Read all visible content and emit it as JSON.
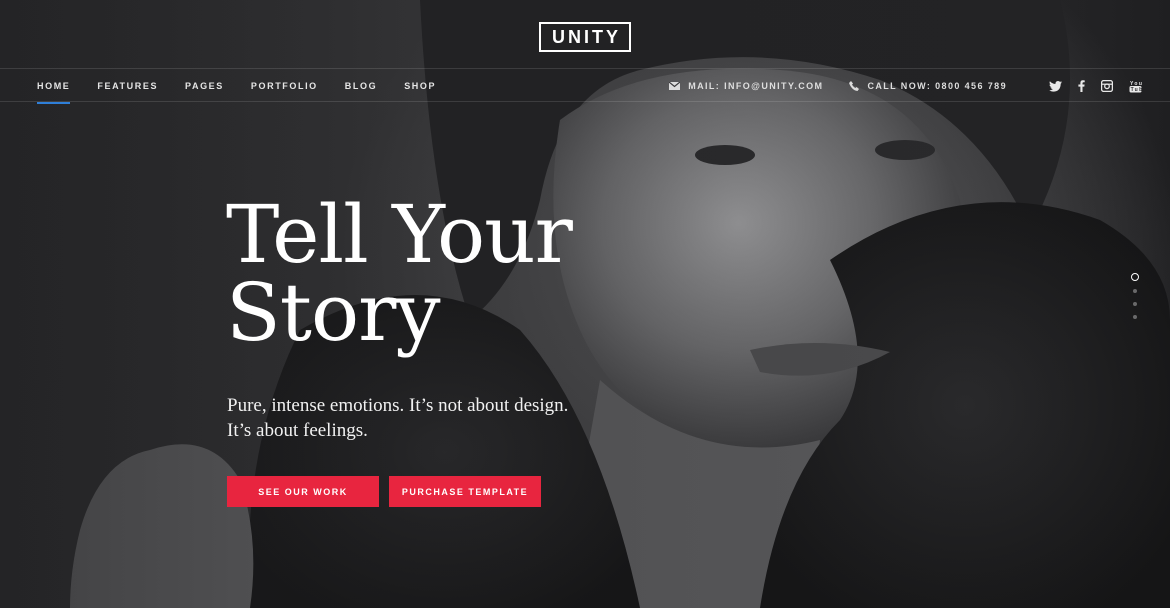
{
  "brand": {
    "logo_text": "UNITY"
  },
  "nav": {
    "items": [
      {
        "label": "HOME",
        "active": true
      },
      {
        "label": "FEATURES",
        "active": false
      },
      {
        "label": "PAGES",
        "active": false
      },
      {
        "label": "PORTFOLIO",
        "active": false
      },
      {
        "label": "BLOG",
        "active": false
      },
      {
        "label": "SHOP",
        "active": false
      }
    ],
    "active_color": "#2f7fd8"
  },
  "contact": {
    "mail": {
      "icon": "envelope-icon",
      "text": "MAIL: INFO@UNITY.COM"
    },
    "phone": {
      "icon": "phone-icon",
      "text": "CALL NOW: 0800 456 789"
    }
  },
  "social": [
    {
      "icon": "twitter-icon"
    },
    {
      "icon": "facebook-icon"
    },
    {
      "icon": "instagram-icon"
    },
    {
      "icon": "youtube-icon"
    }
  ],
  "hero": {
    "headline_line1": "Tell Your",
    "headline_line2": "Story",
    "subtext_line1": "Pure, intense emotions. It’s not about design.",
    "subtext_line2": "It’s about feelings.",
    "buttons": {
      "primary": "SEE OUR WORK",
      "secondary": "PURCHASE TEMPLATE"
    },
    "button_color": "#e8253f"
  },
  "slider": {
    "total": 4,
    "active": 1
  }
}
